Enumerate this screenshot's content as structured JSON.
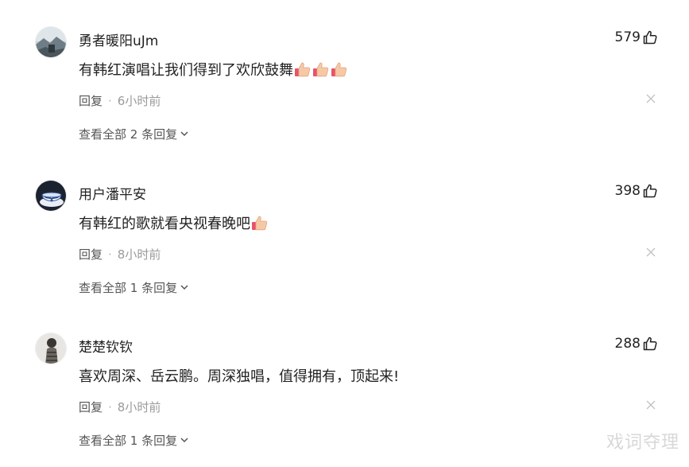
{
  "comments": [
    {
      "username": "勇者暖阳uJm",
      "likes": "579",
      "content": "有韩红演唱让我们得到了欢欣鼓舞",
      "emoji_count": 3,
      "reply_label": "回复",
      "time": "6小时前",
      "view_all": "查看全部 2 条回复",
      "avatar_icon": "landscape-avatar"
    },
    {
      "username": "用户潘平安",
      "likes": "398",
      "content": "有韩红的歌就看央视春晚吧",
      "emoji_count": 1,
      "reply_label": "回复",
      "time": "8小时前",
      "view_all": "查看全部 1 条回复",
      "avatar_icon": "porcelain-avatar"
    },
    {
      "username": "楚楚钦钦",
      "likes": "288",
      "content": "喜欢周深、岳云鹏。周深独唱，值得拥有，顶起来!",
      "emoji_count": 0,
      "reply_label": "回复",
      "time": "8小时前",
      "view_all": "查看全部 1 条回复",
      "avatar_icon": "person-avatar"
    }
  ],
  "icons": {
    "like": "thumbs-up-icon",
    "close": "close-icon",
    "expand": "chevron-down-icon",
    "emoji": "thumbs-up-emoji"
  },
  "colors": {
    "text": "#222222",
    "meta": "#9a9a9a",
    "emoji_skin": "#f6c9a6",
    "emoji_cuff": "#e8536a"
  },
  "watermark": "戏词夺理"
}
